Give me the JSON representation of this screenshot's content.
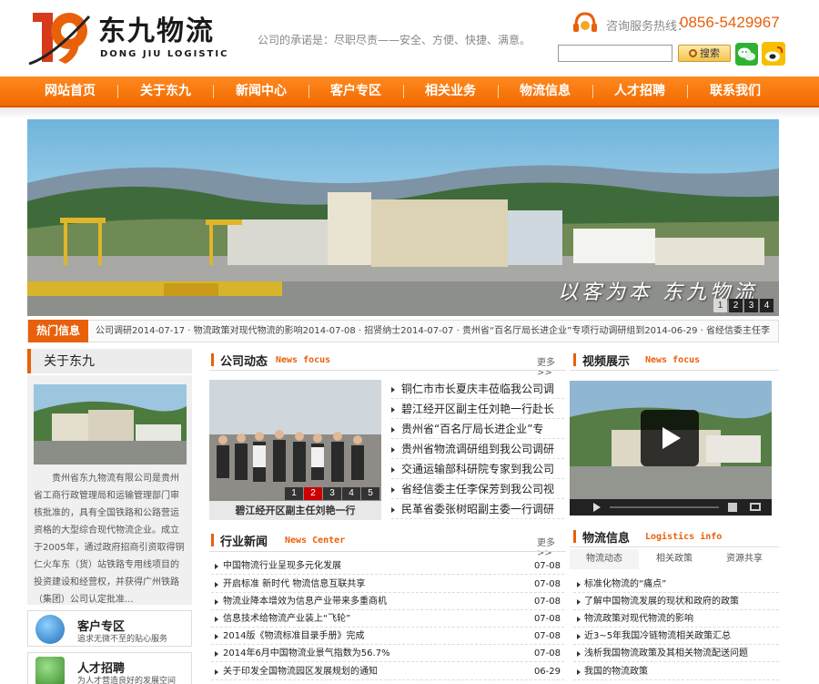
{
  "header": {
    "logo_cn": "东九物流",
    "logo_en": "DONG JIU LOGISTIC",
    "slogan": "公司的承诺是：尽职尽责——安全、方便、快捷、满意。",
    "hotline_label": "咨询服务热线：",
    "hotline_number": "0856-5429967",
    "search_button": "搜索",
    "search_value": ""
  },
  "nav": {
    "items": [
      "网站首页",
      "关于东九",
      "新闻中心",
      "客户专区",
      "相关业务",
      "物流信息",
      "人才招聘",
      "联系我们"
    ]
  },
  "banner": {
    "caption": "以客为本 东九物流",
    "pages": [
      "1",
      "2",
      "3",
      "4"
    ],
    "active_page": 1
  },
  "hot": {
    "label": "热门信息",
    "text": "公司调研2014-07-17 · 物流政策对现代物流的影响2014-07-08 · 招贤纳士2014-07-07 · 贵州省“百名厅局长进企业”专项行动调研组到2014-06-29 · 省经信委主任李"
  },
  "about": {
    "title": "关于东九",
    "text": "贵州省东九物流有限公司是贵州省工商行政管理局和运输管理部门审核批准的，具有全国铁路和公路营运资格的大型综合现代物流企业。成立于2005年，通过政府招商引资取得铜仁火车东（货）站铁路专用线项目的投资建设和经营权，并获得广州铁路（集团）公司认定批准..."
  },
  "side_boxes": [
    {
      "title": "客户专区",
      "subtitle": "追求无微不至的贴心服务"
    },
    {
      "title": "人才招聘",
      "subtitle": "为人才营造良好的发展空间"
    }
  ],
  "company_news": {
    "title": "公司动态",
    "en": "News focus",
    "more": "更多>>",
    "photo_caption": "碧江经开区副主任刘艳一行",
    "photo_pages": [
      "1",
      "2",
      "3",
      "4",
      "5"
    ],
    "photo_active": 2,
    "items": [
      "铜仁市市长夏庆丰莅临我公司调",
      "碧江经开区副主任刘艳一行赴长",
      "贵州省“百名厅局长进企业”专",
      "贵州省物流调研组到我公司调研",
      "交通运输部科研院专家到我公司",
      "省经信委主任李保芳到我公司视",
      "民革省委张树昭副主委一行调研"
    ]
  },
  "industry_news": {
    "title": "行业新闻",
    "en": "News Center",
    "more": "更多>>",
    "items": [
      {
        "title": "中国物流行业呈现多元化发展",
        "date": "07-08"
      },
      {
        "title": "开启标准 新时代 物流信息互联共享",
        "date": "07-08"
      },
      {
        "title": "物流业降本增效为信息产业带来多重商机",
        "date": "07-08"
      },
      {
        "title": "信息技术给物流产业装上“飞轮”",
        "date": "07-08"
      },
      {
        "title": "2014版《物流标准目录手册》完成",
        "date": "07-08"
      },
      {
        "title": "2014年6月中国物流业景气指数为56.7%",
        "date": "07-08"
      },
      {
        "title": "关于印发全国物流园区发展规划的通知",
        "date": "06-29"
      }
    ]
  },
  "video": {
    "title": "视频展示",
    "en": "News focus"
  },
  "logistics_info": {
    "title": "物流信息",
    "en": "Logistics info",
    "tabs": [
      "物流动态",
      "相关政策",
      "资源共享"
    ],
    "items": [
      "标准化物流的“痛点”",
      "了解中国物流发展的现状和政府的政策",
      "物流政策对现代物流的影响",
      "近3~5年我国冷链物流相关政策汇总",
      "浅析我国物流政策及其相关物流配送问题",
      "我国的物流政策"
    ]
  },
  "colors": {
    "accent": "#e8600a",
    "nav": "#f47a10"
  }
}
